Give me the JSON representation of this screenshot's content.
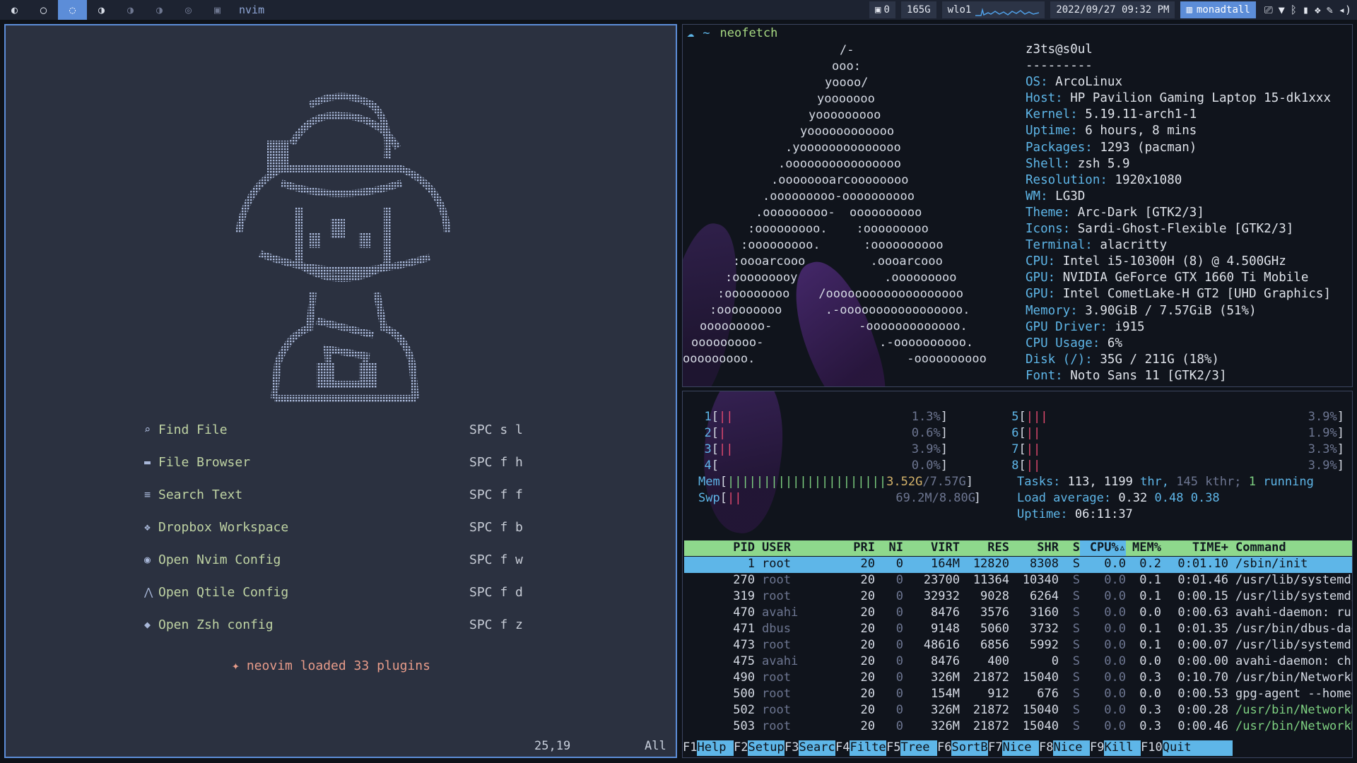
{
  "topbar": {
    "workspaces": [
      "◐",
      "◯",
      "◌",
      "◑",
      "◑",
      "◑",
      "◎",
      "▣"
    ],
    "window_title": "nvim",
    "widgets": {
      "notif": "0",
      "disk": "165G",
      "net_iface": "wlo1",
      "datetime": "2022/09/27 09:32 PM",
      "layout": "monadtall"
    },
    "colors": {
      "bar_bg": "#1d2331",
      "accent": "#5c8dd8"
    }
  },
  "nvim": {
    "menu": [
      {
        "icon": "search-file-icon",
        "glyph": "⌕",
        "label": "Find  File",
        "key": "SPC s l"
      },
      {
        "icon": "folder-icon",
        "glyph": "▬",
        "label": "File Browser",
        "key": "SPC f h"
      },
      {
        "icon": "text-lines-icon",
        "glyph": "≡",
        "label": "Search Text",
        "key": "SPC f f"
      },
      {
        "icon": "dropbox-icon",
        "glyph": "❖",
        "label": "Dropbox Workspace",
        "key": "SPC f b"
      },
      {
        "icon": "nvim-icon",
        "glyph": "◉",
        "label": "Open Nvim Config",
        "key": "SPC f w"
      },
      {
        "icon": "qtile-icon",
        "glyph": "⋀",
        "label": "Open Qtile Config",
        "key": "SPC f d"
      },
      {
        "icon": "shell-icon",
        "glyph": "◆",
        "label": "Open Zsh config",
        "key": "SPC f z"
      }
    ],
    "plugins_msg": "neovim loaded 33 plugins",
    "party_glyph": "✦",
    "cursor_pos": "25,19",
    "scroll_pos": "All"
  },
  "neofetch": {
    "prompt_arrow": "☁",
    "prompt_dir": "~",
    "command": "neofetch",
    "logo_lines": [
      "/-",
      "ooo:",
      "yoooo/",
      "yooooooo",
      "yooooooooo",
      "yoooooooooooo",
      ".yoooooooooooooo",
      ".oooooooooooooooo",
      ".oooooooarcoooooooo",
      ".ooooooooo-oooooooooo",
      ".ooooooooo-  oooooooooo",
      ":ooooooooo.    :ooooooooo",
      ":ooooooooo.      :oooooooooo",
      ":oooarcooo         .oooarcooo",
      ":ooooooooy            .ooooooooo",
      ":ooooooooo    /ooooooooooooooooooo",
      ":ooooooooo      .-ooooooooooooooooo.",
      "ooooooooo-            -ooooooooooooo.",
      "ooooooooo-                .-oooooooooo.",
      "ooooooooo.                     -oooooooooo"
    ],
    "header": "z3ts@s0ul",
    "separator": "---------",
    "info": [
      {
        "k": "OS",
        "v": "ArcoLinux"
      },
      {
        "k": "Host",
        "v": "HP Pavilion Gaming Laptop 15-dk1xxx"
      },
      {
        "k": "Kernel",
        "v": "5.19.11-arch1-1"
      },
      {
        "k": "Uptime",
        "v": "6 hours, 8 mins"
      },
      {
        "k": "Packages",
        "v": "1293 (pacman)"
      },
      {
        "k": "Shell",
        "v": "zsh 5.9"
      },
      {
        "k": "Resolution",
        "v": "1920x1080"
      },
      {
        "k": "WM",
        "v": "LG3D"
      },
      {
        "k": "Theme",
        "v": "Arc-Dark [GTK2/3]"
      },
      {
        "k": "Icons",
        "v": "Sardi-Ghost-Flexible [GTK2/3]"
      },
      {
        "k": "Terminal",
        "v": "alacritty"
      },
      {
        "k": "CPU",
        "v": "Intel i5-10300H (8) @ 4.500GHz"
      },
      {
        "k": "GPU",
        "v": "NVIDIA GeForce GTX 1660 Ti Mobile"
      },
      {
        "k": "GPU",
        "v": "Intel CometLake-H GT2 [UHD Graphics]"
      },
      {
        "k": "Memory",
        "v": "3.90GiB / 7.57GiB (51%)"
      },
      {
        "k": "GPU Driver",
        "v": "i915"
      },
      {
        "k": "CPU Usage",
        "v": "6%"
      },
      {
        "k": "Disk (/)",
        "v": "35G / 211G (18%)"
      },
      {
        "k": "Font",
        "v": "Noto Sans 11 [GTK2/3]"
      }
    ]
  },
  "htop": {
    "cpus": [
      {
        "n": "1",
        "bars": "||",
        "pct": "1.3%"
      },
      {
        "n": "2",
        "bars": "|",
        "pct": "0.6%"
      },
      {
        "n": "3",
        "bars": "||",
        "pct": "3.9%"
      },
      {
        "n": "4",
        "bars": "",
        "pct": "0.0%"
      },
      {
        "n": "5",
        "bars": "|||",
        "pct": "3.9%"
      },
      {
        "n": "6",
        "bars": "||",
        "pct": "1.9%"
      },
      {
        "n": "7",
        "bars": "||",
        "pct": "3.3%"
      },
      {
        "n": "8",
        "bars": "||",
        "pct": "3.9%"
      }
    ],
    "mem": {
      "label": "Mem",
      "bars": "||||||||||||||||||||||",
      "used": "3.52G",
      "total": "/7.57G"
    },
    "swp": {
      "label": "Swp",
      "bars": "||",
      "value": "69.2M/8.80G"
    },
    "tasks": {
      "label": "Tasks:",
      "procs": "113,",
      "thr": "1199",
      "thr_label": "thr,",
      "kthr": "145",
      "kthr_label": "kthr;",
      "running": "1",
      "running_label": "running"
    },
    "load": {
      "label": "Load average:",
      "v1": "0.32",
      "v5": "0.48",
      "v15": "0.38"
    },
    "uptime": {
      "label": "Uptime:",
      "value": "06:11:37"
    },
    "columns": [
      "PID",
      "USER",
      "PRI",
      "NI",
      "VIRT",
      "RES",
      "SHR",
      "S",
      "CPU%▵",
      "MEM%",
      "TIME+",
      "Command"
    ],
    "rows": [
      {
        "pid": "1",
        "user": "root",
        "pri": "20",
        "ni": "0",
        "virt": "164M",
        "res": "12820",
        "shr": "8308",
        "s": "S",
        "cpu": "0.0",
        "mem": "0.2",
        "time": "0:01.10",
        "cmd": "/sbin/init",
        "sel": true
      },
      {
        "pid": "270",
        "user": "root",
        "pri": "20",
        "ni": "0",
        "virt": "23700",
        "res": "11364",
        "shr": "10340",
        "s": "S",
        "cpu": "0.0",
        "mem": "0.1",
        "time": "0:01.46",
        "cmd": "/usr/lib/systemd/sy"
      },
      {
        "pid": "319",
        "user": "root",
        "pri": "20",
        "ni": "0",
        "virt": "32932",
        "res": "9028",
        "shr": "6264",
        "s": "S",
        "cpu": "0.0",
        "mem": "0.1",
        "time": "0:00.15",
        "cmd": "/usr/lib/systemd/sy"
      },
      {
        "pid": "470",
        "user": "avahi",
        "pri": "20",
        "ni": "0",
        "virt": "8476",
        "res": "3576",
        "shr": "3160",
        "s": "S",
        "cpu": "0.0",
        "mem": "0.0",
        "time": "0:00.63",
        "cmd": "avahi-daemon: runni"
      },
      {
        "pid": "471",
        "user": "dbus",
        "pri": "20",
        "ni": "0",
        "virt": "9148",
        "res": "5060",
        "shr": "3732",
        "s": "S",
        "cpu": "0.0",
        "mem": "0.1",
        "time": "0:01.35",
        "cmd": "/usr/bin/dbus-daemo"
      },
      {
        "pid": "473",
        "user": "root",
        "pri": "20",
        "ni": "0",
        "virt": "48616",
        "res": "6856",
        "shr": "5992",
        "s": "S",
        "cpu": "0.0",
        "mem": "0.1",
        "time": "0:00.07",
        "cmd": "/usr/lib/systemd/sy"
      },
      {
        "pid": "475",
        "user": "avahi",
        "pri": "20",
        "ni": "0",
        "virt": "8476",
        "res": "400",
        "shr": "0",
        "s": "S",
        "cpu": "0.0",
        "mem": "0.0",
        "time": "0:00.00",
        "cmd": "avahi-daemon: chroo"
      },
      {
        "pid": "490",
        "user": "root",
        "pri": "20",
        "ni": "0",
        "virt": "326M",
        "res": "21872",
        "shr": "15040",
        "s": "S",
        "cpu": "0.0",
        "mem": "0.3",
        "time": "0:10.70",
        "cmd": "/usr/bin/NetworkMan"
      },
      {
        "pid": "500",
        "user": "root",
        "pri": "20",
        "ni": "0",
        "virt": "154M",
        "res": "912",
        "shr": "676",
        "s": "S",
        "cpu": "0.0",
        "mem": "0.0",
        "time": "0:00.53",
        "cmd": "gpg-agent --homedir"
      },
      {
        "pid": "502",
        "user": "root",
        "pri": "20",
        "ni": "0",
        "virt": "326M",
        "res": "21872",
        "shr": "15040",
        "s": "S",
        "cpu": "0.0",
        "mem": "0.3",
        "time": "0:00.28",
        "cmd": "/usr/bin/NetworkMan",
        "green": true
      },
      {
        "pid": "503",
        "user": "root",
        "pri": "20",
        "ni": "0",
        "virt": "326M",
        "res": "21872",
        "shr": "15040",
        "s": "S",
        "cpu": "0.0",
        "mem": "0.3",
        "time": "0:00.46",
        "cmd": "/usr/bin/NetworkMan",
        "green": true
      }
    ],
    "fkeys": [
      {
        "key": "F1",
        "act": "Help"
      },
      {
        "key": "F2",
        "act": "Setup"
      },
      {
        "key": "F3",
        "act": "Search"
      },
      {
        "key": "F4",
        "act": "Filter"
      },
      {
        "key": "F5",
        "act": "Tree"
      },
      {
        "key": "F6",
        "act": "SortBy"
      },
      {
        "key": "F7",
        "act": "Nice -"
      },
      {
        "key": "F8",
        "act": "Nice +"
      },
      {
        "key": "F9",
        "act": "Kill"
      },
      {
        "key": "F10",
        "act": "Quit"
      }
    ]
  }
}
